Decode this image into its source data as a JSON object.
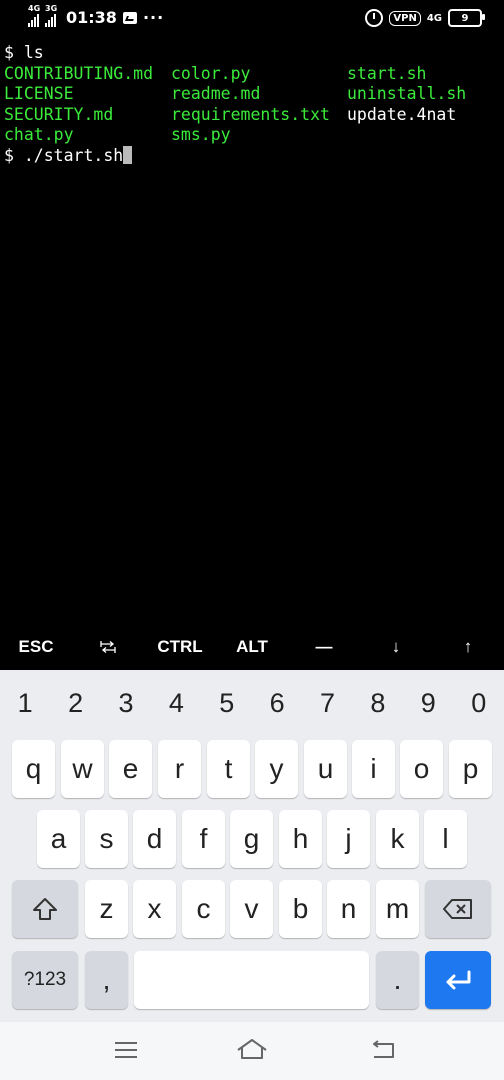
{
  "status_bar": {
    "signal1_label": "4G",
    "signal2_label": "3G",
    "time": "01:38",
    "dots": "···",
    "vpn": "VPN",
    "net": "4G",
    "battery": "9",
    "icons": [
      "message-icon",
      "alarm-icon",
      "vpn-icon",
      "battery-icon"
    ]
  },
  "terminal": {
    "prompt1": "$ ls",
    "files": [
      [
        "CONTRIBUTING.md",
        "color.py",
        "start.sh"
      ],
      [
        "LICENSE",
        "readme.md",
        "uninstall.sh"
      ],
      [
        "SECURITY.md",
        "requirements.txt",
        "update.4nat"
      ],
      [
        "chat.py",
        "sms.py",
        ""
      ]
    ],
    "prompt2": "$ ./start.sh",
    "colors": {
      "green": "#3bea3b",
      "white": "#ffffff"
    }
  },
  "extra_keys": [
    "ESC",
    "⭾",
    "CTRL",
    "ALT",
    "—",
    "↓",
    "↑"
  ],
  "keyboard": {
    "numbers": [
      "1",
      "2",
      "3",
      "4",
      "5",
      "6",
      "7",
      "8",
      "9",
      "0"
    ],
    "row1": [
      "q",
      "w",
      "e",
      "r",
      "t",
      "y",
      "u",
      "i",
      "o",
      "p"
    ],
    "row2": [
      "a",
      "s",
      "d",
      "f",
      "g",
      "h",
      "j",
      "k",
      "l"
    ],
    "row3": [
      "z",
      "x",
      "c",
      "v",
      "b",
      "n",
      "m"
    ],
    "symbols_key": "?123",
    "comma_key": ",",
    "period_key": ".",
    "enter_color": "#1e78f0"
  },
  "nav": {
    "icons": [
      "menu-icon",
      "home-icon",
      "back-icon"
    ]
  }
}
